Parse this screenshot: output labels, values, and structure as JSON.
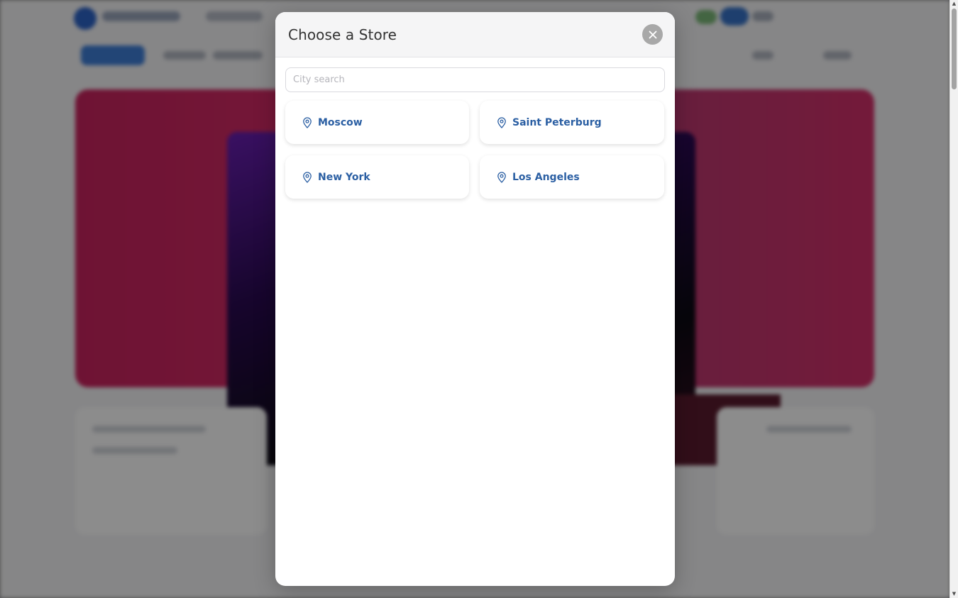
{
  "modal": {
    "title": "Choose a Store",
    "close_icon": "close-icon",
    "search": {
      "placeholder": "City search",
      "value": ""
    },
    "cities": [
      {
        "name": "Moscow",
        "icon": "map-pin-icon"
      },
      {
        "name": "Saint Peterburg",
        "icon": "map-pin-icon"
      },
      {
        "name": "New York",
        "icon": "map-pin-icon"
      },
      {
        "name": "Los Angeles",
        "icon": "map-pin-icon"
      }
    ]
  },
  "colors": {
    "city_text": "#2b5fa3",
    "close_button": "#a8a8a8",
    "overlay": "rgba(0,0,0,0.45)"
  }
}
